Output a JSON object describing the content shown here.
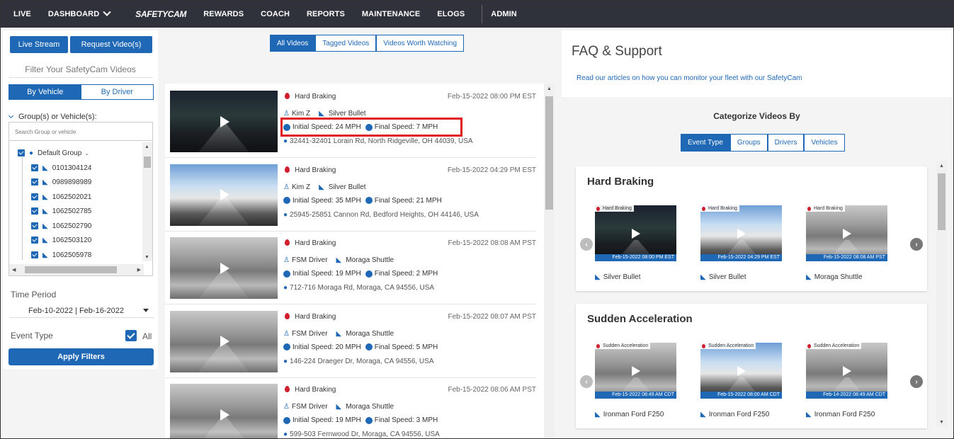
{
  "nav": {
    "items": [
      "LIVE",
      "DASHBOARD",
      "SAFETYCAM",
      "REWARDS",
      "COACH",
      "REPORTS",
      "MAINTENANCE",
      "ELOGS",
      "ADMIN"
    ]
  },
  "left": {
    "live_stream": "Live Stream",
    "request_videos": "Request Video(s)",
    "filter_title": "Filter Your SafetyCam Videos",
    "by_vehicle": "By Vehicle",
    "by_driver": "By Driver",
    "groups_label": "Group(s) or Vehicle(s):",
    "search_placeholder": "Search Group or vehicle",
    "default_group": "Default Group",
    "vehicles": [
      "0101304124",
      "0989898989",
      "1062502021",
      "1062502785",
      "1062502790",
      "1062503120",
      "1062505978"
    ],
    "time_period_label": "Time Period",
    "date_range": "Feb-10-2022 | Feb-16-2022",
    "event_type_label": "Event Type",
    "all_label": "All",
    "apply_filters": "Apply Filters"
  },
  "mid": {
    "tabs": [
      "All Videos",
      "Tagged Videos",
      "Videos Worth Watching"
    ],
    "events": [
      {
        "title": "Hard Braking",
        "date": "Feb-15-2022 08:00 PM EST",
        "driver": "Kim Z",
        "vehicle": "Silver Bullet",
        "initial": "Initial Speed: 24 MPH",
        "final": "Final Speed: 7 MPH",
        "address": "32441-32401 Lorain Rd, North Ridgeville, OH 44039, USA"
      },
      {
        "title": "Hard Braking",
        "date": "Feb-15-2022 04:29 PM EST",
        "driver": "Kim Z",
        "vehicle": "Silver Bullet",
        "initial": "Initial Speed: 35 MPH",
        "final": "Final Speed: 21 MPH",
        "address": "25945-25851 Cannon Rd, Bedford Heights, OH 44146, USA"
      },
      {
        "title": "Hard Braking",
        "date": "Feb-15-2022 08:08 AM PST",
        "driver": "FSM Driver",
        "vehicle": "Moraga Shuttle",
        "initial": "Initial Speed: 19 MPH",
        "final": "Final Speed: 2 MPH",
        "address": "712-716 Moraga Rd, Moraga, CA 94556, USA"
      },
      {
        "title": "Hard Braking",
        "date": "Feb-15-2022 08:07 AM PST",
        "driver": "FSM Driver",
        "vehicle": "Moraga Shuttle",
        "initial": "Initial Speed: 20 MPH",
        "final": "Final Speed: 5 MPH",
        "address": "146-224 Draeger Dr, Moraga, CA 94556, USA"
      },
      {
        "title": "Hard Braking",
        "date": "Feb-15-2022 08:06 AM PST",
        "driver": "FSM Driver",
        "vehicle": "Moraga Shuttle",
        "initial": "Initial Speed: 19 MPH",
        "final": "Final Speed: 3 MPH",
        "address": "599-503 Fernwood Dr, Moraga, CA 94556, USA"
      }
    ]
  },
  "right": {
    "faq_title": "FAQ & Support",
    "faq_link": "Read our articles on how you can monitor your fleet with our SafetyCam",
    "categorize_title": "Categorize Videos By",
    "cat_tabs": [
      "Event Type",
      "Groups",
      "Drivers",
      "Vehicles"
    ],
    "categories": [
      {
        "title": "Hard Braking",
        "videos": [
          {
            "tag": "Hard Braking",
            "stamp": "Feb-15-2022 08:00 PM EST",
            "vehicle": "Silver Bullet"
          },
          {
            "tag": "Hard Braking",
            "stamp": "Feb-15-2022 04:29 PM EST",
            "vehicle": "Silver Bullet"
          },
          {
            "tag": "Hard Braking",
            "stamp": "Feb-15-2022 08:08 AM PST",
            "vehicle": "Moraga Shuttle"
          }
        ]
      },
      {
        "title": "Sudden Acceleration",
        "videos": [
          {
            "tag": "Sudden Acceleration",
            "stamp": "Feb-15-2022 08:49 AM CDT",
            "vehicle": "Ironman Ford F250"
          },
          {
            "tag": "Sudden Acceleration",
            "stamp": "Feb-15-2022 08:00 AM CDT",
            "vehicle": "Ironman Ford F250"
          },
          {
            "tag": "Sudden Acceleration",
            "stamp": "Feb-14-2022 08:49 AM CDT",
            "vehicle": "Ironman Ford F250"
          }
        ]
      }
    ]
  },
  "colors": {
    "nav_bg": "#2f323b",
    "accent": "#1f68b5",
    "event_red": "#d0202e",
    "highlight": "#e01b22"
  }
}
